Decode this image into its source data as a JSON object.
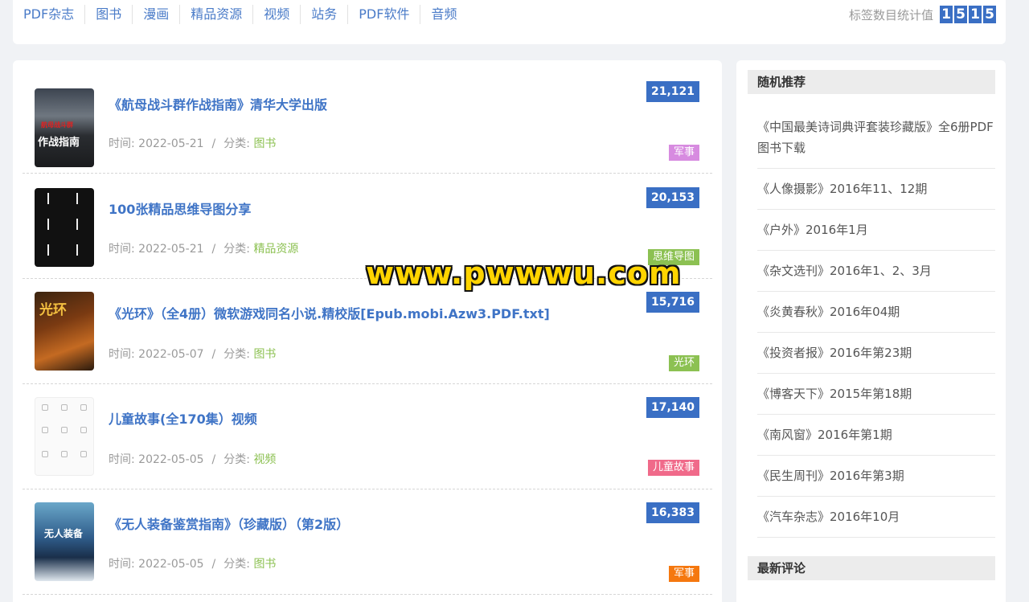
{
  "nav": {
    "items": [
      "PDF杂志",
      "图书",
      "漫画",
      "精品资源",
      "视频",
      "站务",
      "PDF软件",
      "音频"
    ],
    "tag_count_label": "标签数目统计值",
    "tag_count_digits": [
      "1",
      "5",
      "1",
      "5"
    ]
  },
  "posts": [
    {
      "title": "《航母战斗群作战指南》清华大学出版",
      "time_label": "时间: ",
      "date": "2022-05-21",
      "cat_label": "分类: ",
      "category": "图书",
      "views": "21,121",
      "tag": "军事",
      "tag_color": "#d78be0",
      "thumb_caption": "作战指南",
      "thumb_caption2": "航母战斗群"
    },
    {
      "title": "100张精品思维导图分享",
      "time_label": "时间: ",
      "date": "2022-05-21",
      "cat_label": "分类: ",
      "category": "精品资源",
      "views": "20,153",
      "tag": "思维导图",
      "tag_color": "#8cc152"
    },
    {
      "title": "《光环》（全4册）微软游戏同名小说.精校版[Epub.mobi.Azw3.PDF.txt]",
      "time_label": "时间: ",
      "date": "2022-05-07",
      "cat_label": "分类: ",
      "category": "图书",
      "views": "15,716",
      "tag": "光环",
      "tag_color": "#8cc152",
      "thumb_caption": "光环"
    },
    {
      "title": "儿童故事(全170集）视频",
      "time_label": "时间: ",
      "date": "2022-05-05",
      "cat_label": "分类: ",
      "category": "视频",
      "views": "17,140",
      "tag": "儿童故事",
      "tag_color": "#f06a8a"
    },
    {
      "title": "《无人装备鉴赏指南》（珍藏版）（第2版）",
      "time_label": "时间: ",
      "date": "2022-05-05",
      "cat_label": "分类: ",
      "category": "图书",
      "views": "16,383",
      "tag": "军事",
      "tag_color": "#f5780f",
      "thumb_caption": "无人装备"
    }
  ],
  "sidebar": {
    "random_title": "随机推荐",
    "random_items": [
      "《中国最美诗词典评套装珍藏版》全6册PDF图书下载",
      "《人像摄影》2016年11、12期",
      "《户外》2016年1月",
      "《杂文选刊》2016年1、2、3月",
      "《炎黄春秋》2016年04期",
      "《投资者报》2016年第23期",
      "《博客天下》2015年第18期",
      "《南风窗》2016年第1期",
      "《民生周刊》2016年第3期",
      "《汽车杂志》2016年10月"
    ],
    "comments_title": "最新评论"
  },
  "watermark": "www.pwwwu.com",
  "colors": {
    "accent": "#3a6fc4",
    "category": "#8cc152",
    "bg": "#f0f2f5"
  }
}
